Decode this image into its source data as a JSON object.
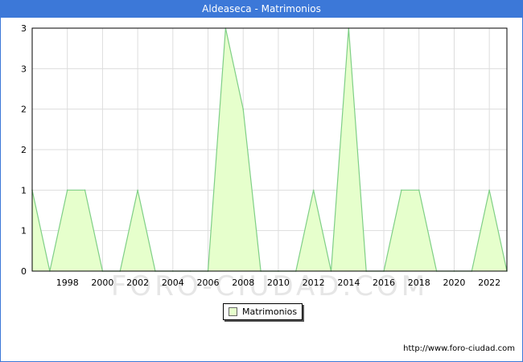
{
  "page": {
    "title": "Aldeaseca - Matrimonios",
    "watermark": "FORO-CIUDAD.COM",
    "credit": "http://www.foro-ciudad.com"
  },
  "colors": {
    "title_bar": "#3c78d8",
    "area_fill": "#e6ffcc",
    "area_line": "#7fcf86",
    "grid": "#dddddd"
  },
  "chart_data": {
    "type": "area",
    "title": "Aldeaseca - Matrimonios",
    "xlabel": "",
    "ylabel": "",
    "x": [
      1996,
      1997,
      1998,
      1999,
      2000,
      2001,
      2002,
      2003,
      2004,
      2005,
      2006,
      2007,
      2008,
      2009,
      2010,
      2011,
      2012,
      2013,
      2014,
      2015,
      2016,
      2017,
      2018,
      2019,
      2020,
      2021,
      2022,
      2023
    ],
    "series": [
      {
        "name": "Matrimonios",
        "values": [
          1,
          0,
          1,
          1,
          0,
          0,
          1,
          0,
          0,
          0,
          0,
          3,
          2,
          0,
          0,
          0,
          1,
          0,
          3,
          0,
          0,
          1,
          1,
          0,
          0,
          0,
          1,
          0
        ]
      }
    ],
    "x_ticks": [
      "1998",
      "2000",
      "2002",
      "2004",
      "2006",
      "2008",
      "2010",
      "2012",
      "2014",
      "2016",
      "2018",
      "2020",
      "2022"
    ],
    "y_ticks": [
      "0",
      "1",
      "1",
      "2",
      "2",
      "3",
      "3"
    ],
    "xlim": [
      1996,
      2023
    ],
    "ylim": [
      0,
      3
    ],
    "grid": true,
    "legend": "bottom-center"
  }
}
